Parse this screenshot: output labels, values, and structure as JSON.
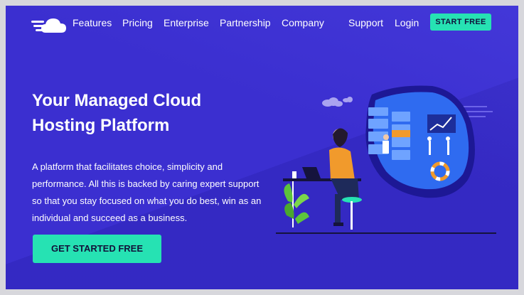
{
  "nav": {
    "links": [
      "Features",
      "Pricing",
      "Enterprise",
      "Partnership",
      "Company"
    ],
    "support": "Support",
    "login": "Login",
    "cta": "START FREE"
  },
  "hero": {
    "title_line1": "Your Managed Cloud",
    "title_line2": "Hosting Platform",
    "description": "A platform that facilitates choice, simplicity and performance. All this is backed by caring expert support so that you stay focused on what you do best, win as an individual and succeed as a business.",
    "cta": "GET STARTED FREE"
  },
  "colors": {
    "background": "#3b2fd0",
    "accent": "#26e2b3",
    "text": "#ffffff",
    "frame": "#d7d7dc"
  },
  "icons": [
    "cloudways-logo-icon",
    "hero-illustration"
  ]
}
